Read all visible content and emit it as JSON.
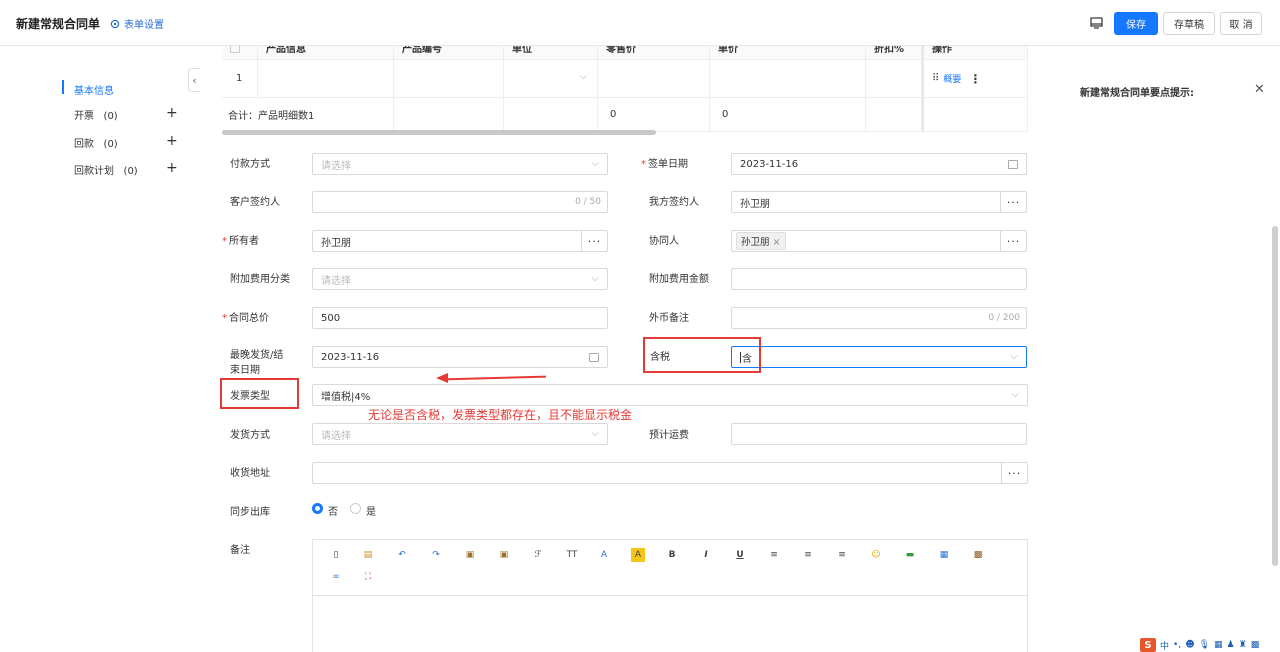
{
  "header": {
    "title": "新建常规合同单",
    "form_settings": "表单设置",
    "save": "保存",
    "draft": "存草稿",
    "cancel": "取 消"
  },
  "nav": {
    "items": [
      {
        "label": "基本信息",
        "count": ""
      },
      {
        "label": "开票",
        "count": "(0)"
      },
      {
        "label": "回款",
        "count": "(0)"
      },
      {
        "label": "回款计划",
        "count": "(0)"
      }
    ]
  },
  "table": {
    "headers": [
      "",
      "产品信息",
      "产品编号",
      "单位",
      "零售价",
      "单价",
      "折扣%",
      "操作"
    ],
    "row1": {
      "index": "1",
      "summary": "概要"
    },
    "total": {
      "label": "合计：产品明细数1",
      "retail": "0",
      "price": "0"
    }
  },
  "form": {
    "payment_method": {
      "label": "付款方式",
      "placeholder": "请选择"
    },
    "sign_date": {
      "label": "签单日期",
      "value": "2023-11-16"
    },
    "client_signer": {
      "label": "客户签约人",
      "counter": "0 / 50"
    },
    "our_signer": {
      "label": "我方签约人",
      "value": "孙卫朋"
    },
    "owner": {
      "label": "所有者",
      "value": "孙卫朋"
    },
    "collaborator": {
      "label": "协同人",
      "tag": "孙卫朋"
    },
    "extra_fee_category": {
      "label": "附加费用分类",
      "placeholder": "请选择"
    },
    "extra_fee_amount": {
      "label": "附加费用金额"
    },
    "contract_total": {
      "label": "合同总价",
      "value": "500"
    },
    "fx_note": {
      "label": "外币备注",
      "counter": "0 / 200"
    },
    "latest_ship": {
      "label_line1": "最晚发货/结",
      "label_line2": "束日期",
      "value": "2023-11-16"
    },
    "tax_included": {
      "label": "含税",
      "value": "含"
    },
    "invoice_type": {
      "label": "发票类型",
      "value": "增值税|4%"
    },
    "ship_method": {
      "label": "发货方式",
      "placeholder": "请选择"
    },
    "est_freight": {
      "label": "预计运费"
    },
    "delivery_address": {
      "label": "收货地址"
    },
    "sync_outbound": {
      "label": "同步出库",
      "no": "否",
      "yes": "是"
    },
    "remarks": {
      "label": "备注"
    }
  },
  "annotation": {
    "text": "无论是否含税，发票类型都存在，且不能显示税金",
    "color": "#e53935"
  },
  "right_panel": {
    "title": "新建常规合同单要点提示:"
  },
  "tray": {
    "ime": "S",
    "lang": "中"
  },
  "colors": {
    "primary": "#1677ff",
    "required": "#e53935"
  }
}
